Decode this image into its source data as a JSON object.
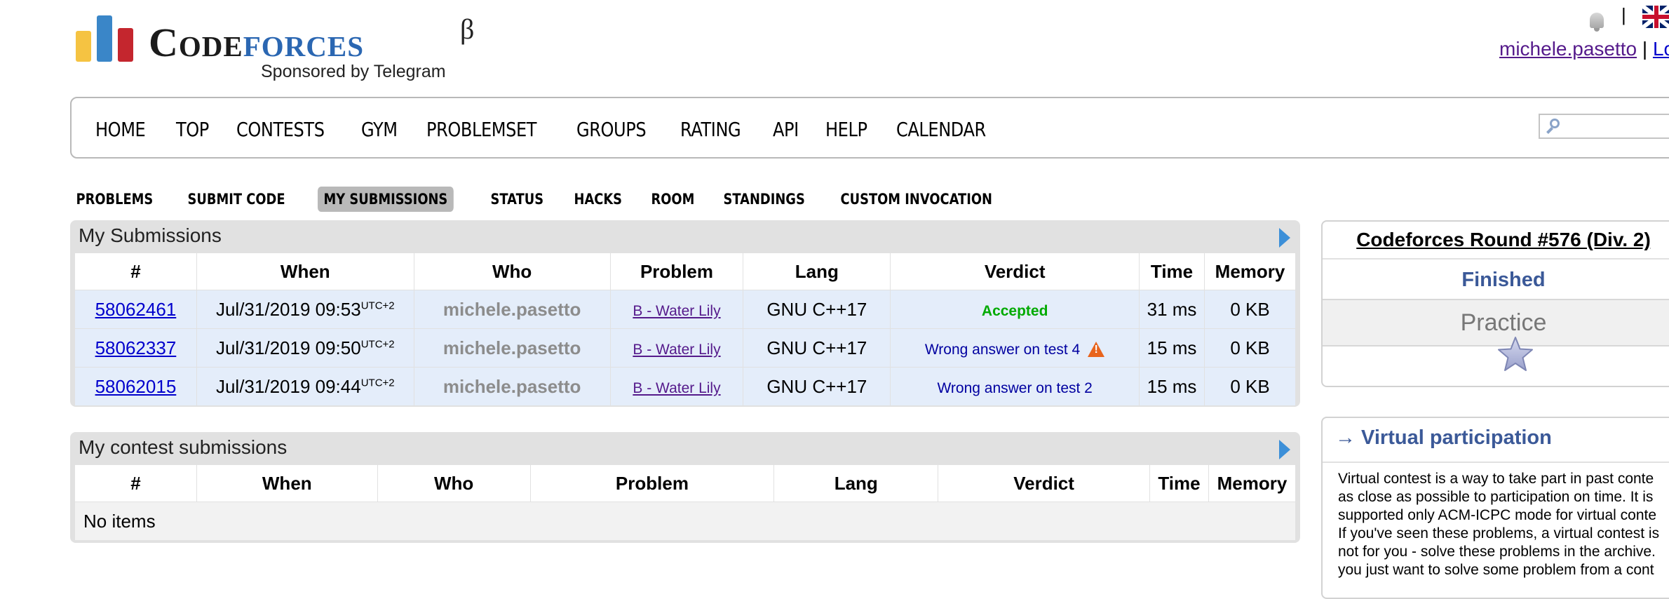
{
  "logo": {
    "brand_part1": "Code",
    "brand_part2": "forces",
    "beta": "β",
    "sponsor": "Sponsored by Telegram"
  },
  "topbar": {
    "separator": "|",
    "username": "michele.pasetto",
    "logout": "Lo"
  },
  "main_menu": [
    "HOME",
    "TOP",
    "CONTESTS",
    "GYM",
    "PROBLEMSET",
    "GROUPS",
    "RATING",
    "API",
    "HELP",
    "CALENDAR"
  ],
  "second_menu": [
    {
      "label": "PROBLEMS",
      "active": false
    },
    {
      "label": "SUBMIT CODE",
      "active": false
    },
    {
      "label": "MY SUBMISSIONS",
      "active": true
    },
    {
      "label": "STATUS",
      "active": false
    },
    {
      "label": "HACKS",
      "active": false
    },
    {
      "label": "ROOM",
      "active": false
    },
    {
      "label": "STANDINGS",
      "active": false
    },
    {
      "label": "CUSTOM INVOCATION",
      "active": false
    }
  ],
  "my_submissions": {
    "title": "My Submissions",
    "columns": [
      "#",
      "When",
      "Who",
      "Problem",
      "Lang",
      "Verdict",
      "Time",
      "Memory"
    ],
    "rows": [
      {
        "id": "58062461",
        "when": "Jul/31/2019 09:53",
        "tz": "UTC+2",
        "who": "michele.pasetto",
        "problem": "B - Water Lily",
        "lang": "GNU C++17",
        "verdict": "Accepted",
        "time": "31 ms",
        "memory": "0 KB"
      },
      {
        "id": "58062337",
        "when": "Jul/31/2019 09:50",
        "tz": "UTC+2",
        "who": "michele.pasetto",
        "problem": "B - Water Lily",
        "lang": "GNU C++17",
        "verdict": "Wrong answer on test 4",
        "time": "15 ms",
        "memory": "0 KB"
      },
      {
        "id": "58062015",
        "when": "Jul/31/2019 09:44",
        "tz": "UTC+2",
        "who": "michele.pasetto",
        "problem": "B - Water Lily",
        "lang": "GNU C++17",
        "verdict": "Wrong answer on test 2",
        "time": "15 ms",
        "memory": "0 KB"
      }
    ]
  },
  "contest_submissions": {
    "title": "My contest submissions",
    "columns": [
      "#",
      "When",
      "Who",
      "Problem",
      "Lang",
      "Verdict",
      "Time",
      "Memory"
    ],
    "empty": "No items"
  },
  "round": {
    "title": "Codeforces Round #576 (Div. 2)",
    "status": "Finished",
    "phase": "Practice"
  },
  "virtual": {
    "title": "→ Virtual participation",
    "lines": [
      "Virtual contest is a way to take part in past conte",
      "as close as possible to participation on time. It is",
      "supported only ACM-ICPC mode for virtual conte",
      "If you've seen these problems, a virtual contest is",
      "not for you - solve these problems in the archive.",
      "you just want to solve some problem from a cont"
    ]
  },
  "colors": {
    "accepted": "#00aa00",
    "wrong": "#0000a0",
    "link": "#0000cc",
    "visited": "#551a8b",
    "accent": "#3b5998"
  }
}
